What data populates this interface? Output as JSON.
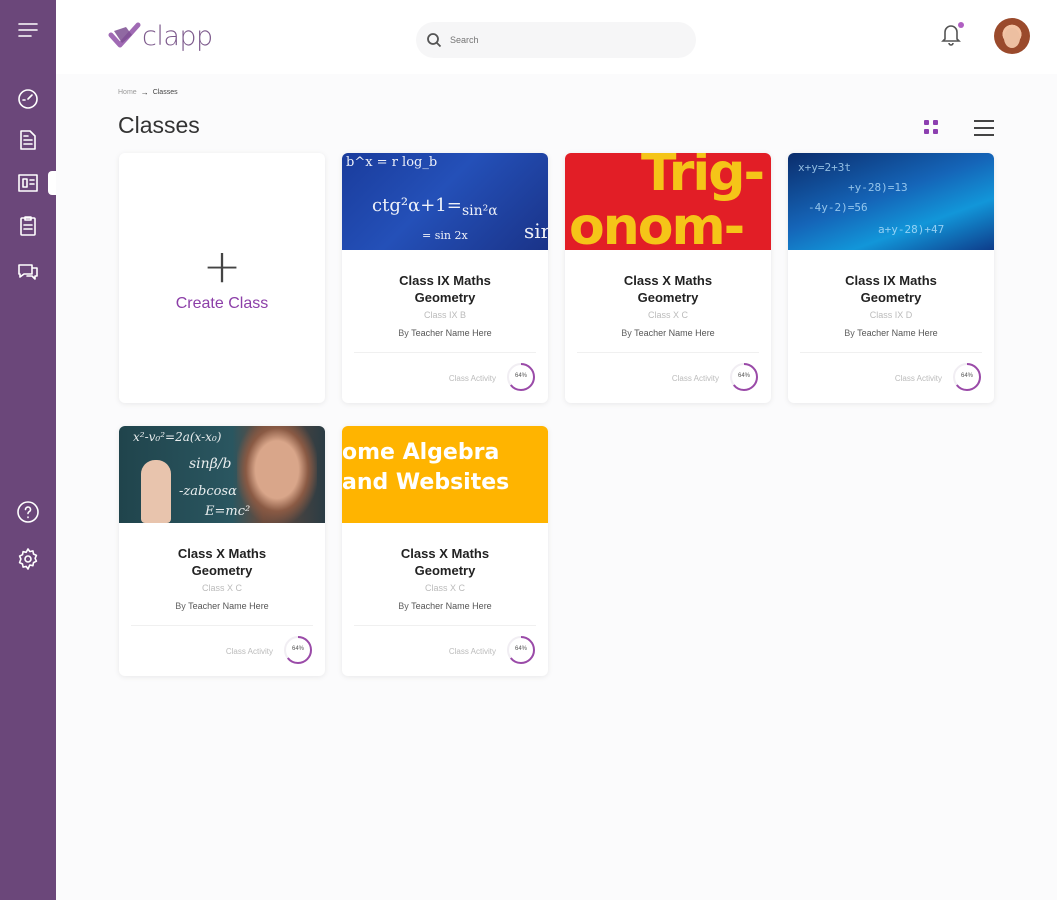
{
  "header": {
    "logo_text": "clapp",
    "search_placeholder": "Search"
  },
  "breadcrumb": {
    "home": "Home",
    "current": "Classes"
  },
  "page": {
    "title": "Classes"
  },
  "create_card": {
    "label": "Create Class"
  },
  "classes": [
    {
      "title_line1": "Class IX Maths",
      "title_line2": "Geometry",
      "section": "Class IX B",
      "by": "By",
      "teacher": "Teacher Name Here",
      "activity_label": "Class Activity",
      "activity_value": "64%",
      "activity_fraction": 0.64,
      "thumbnail": "blue-math-formulas",
      "thumb_text": [
        "b^x = r log_b",
        "ctg²α+1=",
        "sin²α",
        "= sin 2x",
        "sir"
      ]
    },
    {
      "title_line1": "Class X Maths",
      "title_line2": "Geometry",
      "section": "Class X C",
      "by": "By",
      "teacher": "Teacher Name Here",
      "activity_label": "Class Activity",
      "activity_value": "64%",
      "activity_fraction": 0.64,
      "thumbnail": "trigonometry-poster",
      "thumb_text": [
        "Trig-",
        "onom-"
      ]
    },
    {
      "title_line1": "Class IX Maths",
      "title_line2": "Geometry",
      "section": "Class IX D",
      "by": "By",
      "teacher": "Teacher Name Here",
      "activity_label": "Class Activity",
      "activity_value": "64%",
      "activity_fraction": 0.64,
      "thumbnail": "cyan-equations",
      "thumb_text": [
        "x+y=2+3t",
        "+y-28)=13",
        "-4y-2)=56",
        "a+y-28)+47"
      ]
    },
    {
      "title_line1": "Class X Maths",
      "title_line2": "Geometry",
      "section": "Class X C",
      "by": "By",
      "teacher": "Teacher Name Here",
      "activity_label": "Class Activity",
      "activity_value": "64%",
      "activity_fraction": 0.64,
      "thumbnail": "blackboard-equations",
      "thumb_text": [
        "x²-v₀²=2a(x-x₀)",
        "sinβ/b",
        "-zabcosα",
        "E=mc²"
      ]
    },
    {
      "title_line1": "Class X Maths",
      "title_line2": "Geometry",
      "section": "Class X C",
      "by": "By",
      "teacher": "Teacher Name Here",
      "activity_label": "Class Activity",
      "activity_value": "64%",
      "activity_fraction": 0.64,
      "thumbnail": "algebra-websites",
      "thumb_text": [
        "ome Algebra",
        "and Websites"
      ]
    }
  ],
  "icons": {
    "sidebar": [
      "menu-icon",
      "dashboard-icon",
      "document-icon",
      "classroom-icon",
      "clipboard-icon",
      "chat-icon",
      "help-icon",
      "settings-icon"
    ],
    "header": [
      "search-icon",
      "bell-icon"
    ]
  },
  "colors": {
    "sidebar": "#6b477a",
    "accent": "#8c3fa8",
    "notification_dot": "#b05fc2"
  }
}
